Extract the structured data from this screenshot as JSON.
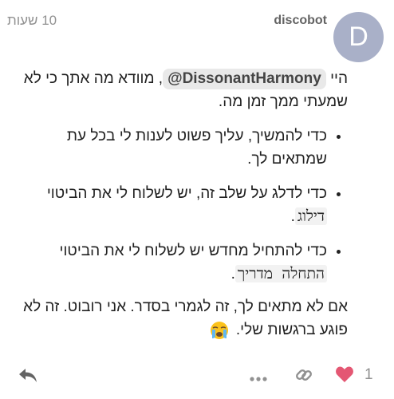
{
  "post": {
    "author": "discobot",
    "avatar_letter": "D",
    "avatar_color": "#a9b0c8",
    "time": "10 שעות",
    "greeting_start": "היי",
    "mention": "@DissonantHarmony",
    "greeting_end": ", מוודא מה אתך כי לא שמעתי ממך זמן מה.",
    "bullets": [
      {
        "text": "כדי להמשיך, עליך פשוט לענות לי בכל עת שמתאים לך."
      },
      {
        "text": "כדי לדלג על שלב זה, יש לשלוח לי את הביטוי",
        "code": "דילוג",
        "suffix": "."
      },
      {
        "text": "כדי להתחיל מחדש יש לשלוח לי את הביטוי",
        "code": "התחלה מדריך",
        "suffix": "."
      }
    ],
    "closing": "אם לא מתאים לך, זה לגמרי בסדר. אני רובוט. זה לא פוגע ברגשות שלי.",
    "closing_emoji": "crying-face-emoji"
  },
  "actions": {
    "like_count": "1",
    "like_color": "#e45773",
    "icon_color": "#919191",
    "reply_icon_color": "#646464"
  }
}
